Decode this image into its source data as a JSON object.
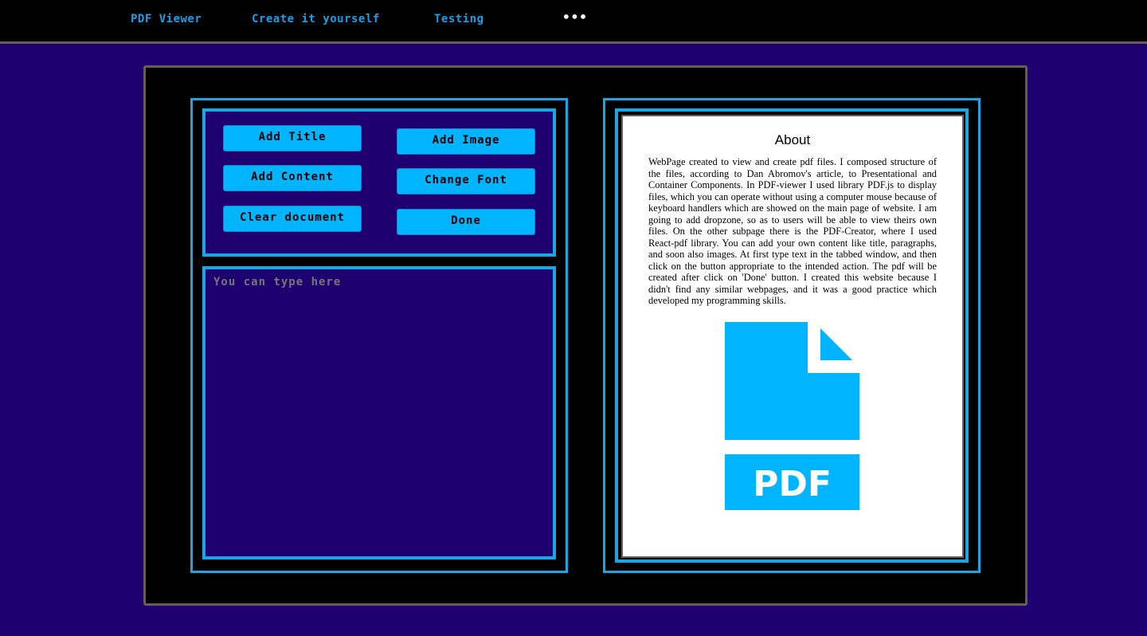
{
  "nav": {
    "links": [
      "PDF Viewer",
      "Create it yourself",
      "Testing"
    ],
    "more": "•••"
  },
  "toolbar": {
    "add_title": "Add Title",
    "add_content": "Add Content",
    "clear_document": "Clear document",
    "add_image": "Add Image",
    "change_font": "Change Font",
    "done": "Done"
  },
  "editor": {
    "placeholder": "You can type here",
    "value": ""
  },
  "preview": {
    "title": "About",
    "body": "WebPage created to view and create pdf files. I composed structure of the files, according to Dan Abromov's article, to Presentational and Container Components. In PDF-viewer I used library PDF.js to display files, which you can operate without using a computer mouse because of keyboard handlers which are showed on the main page of website. I am going to add dropzone, so as to users will be able to view theirs own files. On the other subpage there is the PDF-Creator, where I used React-pdf library. You can add your own content like title, paragraphs, and soon also images. At first type text in the tabbed window, and then click on the button appropriate to the intended action. The pdf will be created after click on 'Done' button. I created this website because I didn't find any similar webpages, and it was a good practice which developed my programming skills.",
    "icon_label": "PDF"
  },
  "colors": {
    "background": "#1e0070",
    "accent": "#00b4ff",
    "border": "#1aa6e4",
    "frame": "#6b5d54"
  }
}
